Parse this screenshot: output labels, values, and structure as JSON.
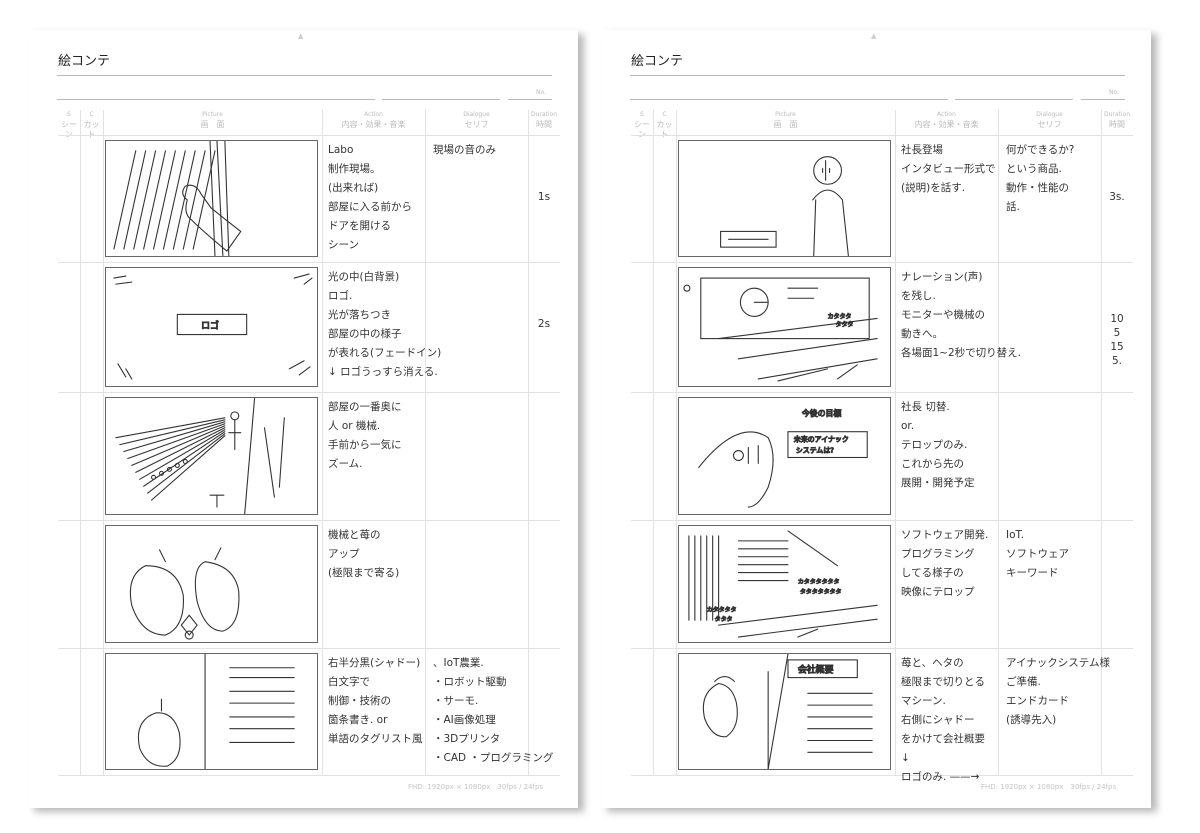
{
  "header": {
    "title": "絵コンテ",
    "no_label": "No.",
    "columns": {
      "scene_en": "S",
      "scene_ja": "シーン",
      "cut_en": "C",
      "cut_ja": "カット",
      "picture_en": "Picture",
      "picture_ja": "画　面",
      "action_en": "Action",
      "action_ja": "内容・効果・音楽",
      "dialogue_en": "Dialogue",
      "dialogue_ja": "セリフ",
      "duration_en": "Duration",
      "duration_ja": "時間"
    },
    "footer": "FHD: 1920px × 1080px　30fps / 24fps"
  },
  "pages": [
    {
      "rows": [
        {
          "sketch": "door",
          "picture_text": [],
          "action": [
            "Labo",
            "制作現場。",
            "(出来れば)",
            "部屋に入る前から",
            "ドアを開ける",
            "シーン"
          ],
          "dialogue": [
            "現場の音のみ"
          ],
          "duration": [
            "1s"
          ]
        },
        {
          "sketch": "logo",
          "picture_text": [
            "ロゴ"
          ],
          "action": [
            "光の中(白背景)",
            "ロゴ.",
            "光が落ちつき",
            "部屋の中の様子",
            "が表れる(フェードイン)",
            "↓ ロゴうっすら消える."
          ],
          "dialogue": [],
          "duration": [
            "2s"
          ]
        },
        {
          "sketch": "rays",
          "picture_text": [],
          "action": [
            "部屋の一番奥に",
            "人 or 機械.",
            "手前から一気に",
            "ズーム."
          ],
          "dialogue": [],
          "duration": []
        },
        {
          "sketch": "strawberry",
          "picture_text": [],
          "action": [
            "機械と苺の",
            "アップ",
            "(極限まで寄る)"
          ],
          "dialogue": [],
          "duration": []
        },
        {
          "sketch": "list",
          "picture_text": [],
          "action": [
            "右半分黒(シャドー)",
            "白文字で",
            "制御・技術の",
            "箇条書き. or",
            "単語のタグリスト風"
          ],
          "dialogue": [
            "、IoT農業.",
            "・ロボット駆動",
            "・サーモ.",
            "・AI画像処理",
            "・3Dプリンタ",
            "・CAD ・プログラミング"
          ],
          "duration": []
        }
      ]
    },
    {
      "rows": [
        {
          "sketch": "president",
          "picture_text": [],
          "action": [
            "社長登場",
            "インタビュー形式で",
            "(説明)を話す."
          ],
          "dialogue": [
            "何ができるか?",
            "という商品.",
            "動作・性能の",
            "話."
          ],
          "duration": [
            "3s."
          ]
        },
        {
          "sketch": "monitor",
          "picture_text": [
            "カタタタ",
            "タタタ"
          ],
          "action": [
            "ナレーション(声)",
            "を残し.",
            "モニターや機械の",
            "動きへ。",
            "各場面1~2秒で切り替え."
          ],
          "dialogue": [],
          "duration": [
            "10",
            "5",
            "15",
            "5."
          ]
        },
        {
          "sketch": "face",
          "picture_text": [
            "今後の目標",
            "未来のアイナック",
            "システムは?"
          ],
          "action": [
            "社長 切替.",
            "or.",
            "テロップのみ.",
            "これから先の",
            "展開・開発予定"
          ],
          "dialogue": [],
          "duration": []
        },
        {
          "sketch": "coding",
          "picture_text": [
            "カタタタタタタ",
            "タタタタタタタ",
            "カタタタタ",
            "タタタ"
          ],
          "action": [
            "ソフトウェア開発.",
            "プログラミング",
            "してる様子の",
            "映像にテロップ"
          ],
          "dialogue": [
            "IoT.",
            "ソフトウェア",
            "キーワード"
          ],
          "duration": []
        },
        {
          "sketch": "company",
          "picture_text": [
            "会社概要"
          ],
          "action": [
            "苺と、ヘタの",
            "極限まで切りとる",
            "マシーン.",
            "右側にシャドー",
            "をかけて会社概要",
            "↓",
            "ロゴのみ. ——→"
          ],
          "dialogue": [
            "アイナックシステム様",
            "ご準備.",
            "",
            "",
            "",
            "エンドカード",
            "(誘導先入)"
          ],
          "duration": []
        }
      ]
    }
  ]
}
